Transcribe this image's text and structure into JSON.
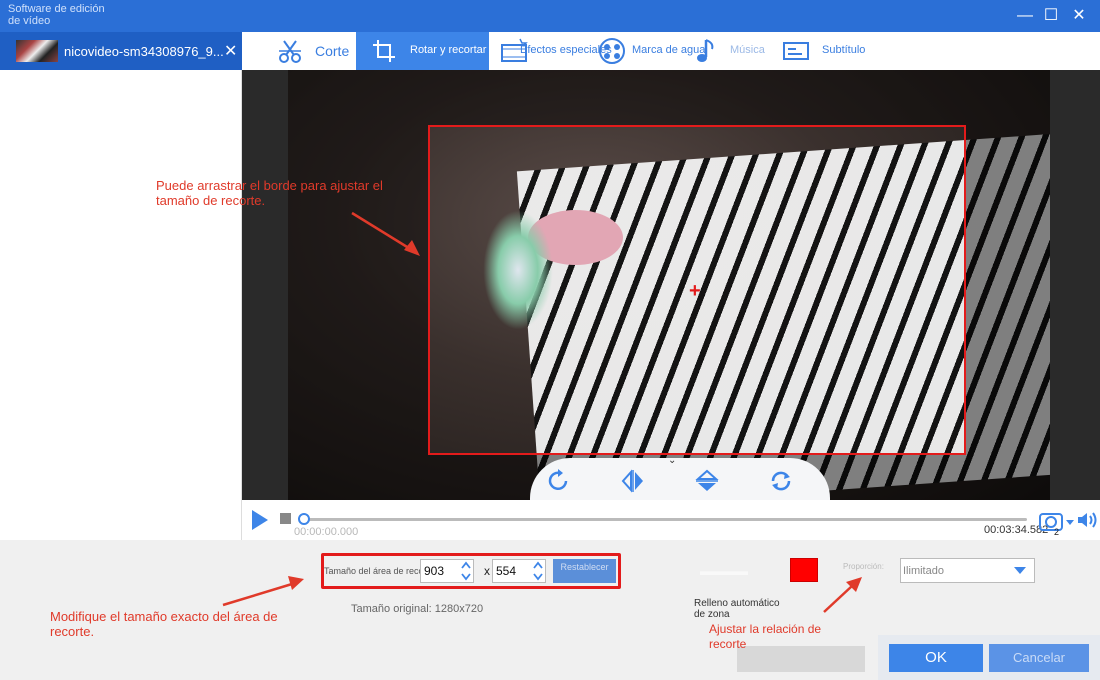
{
  "window": {
    "app_title": "Software de edición de vídeo",
    "minimize": "—",
    "maximize": "☐",
    "close": "✕"
  },
  "file_tab": {
    "name": "nicovideo-sm34308976_9...",
    "close": "✕"
  },
  "toolbar": {
    "tools": [
      {
        "label": "Corte",
        "icon": "scissors-icon"
      },
      {
        "label": "Rotar y recortar",
        "icon": "crop-icon",
        "active": true
      },
      {
        "label": "Efectos especiales",
        "icon": "film-fx-icon"
      },
      {
        "label": "Marca de agua",
        "icon": "watermark-icon"
      },
      {
        "label": "Música",
        "icon": "music-icon"
      },
      {
        "label": "Subtítulo",
        "icon": "subtitle-icon"
      }
    ]
  },
  "annotations": {
    "drag_border": "Puede arrastrar el borde para ajustar el tamaño de recorte.",
    "modify_size": "Modifique el tamaño exacto del área de recorte.",
    "adjust_ratio": "Ajustar la relación de recorte"
  },
  "player": {
    "current_time": "00:00:00.000",
    "total_time": "00:03:34.582",
    "progress": 0.0,
    "snapshot_badge": "2"
  },
  "crop": {
    "label": "Tamaño del área de recorte:",
    "width": "903",
    "x_sep": "x",
    "height": "554",
    "reset_label": "Restablecer",
    "original_size": "Tamaño original: 1280x720",
    "fill_label": "Relleno automático de zona",
    "ratio_label": "Proporción:",
    "ratio_value": "Ilimitado",
    "fill_color": "#ff0000"
  },
  "buttons": {
    "ok": "OK",
    "cancel": "Cancelar"
  },
  "colors": {
    "accent": "#2b6fd6",
    "crop_border": "#e31b1b",
    "annotation": "#e03a2a"
  }
}
